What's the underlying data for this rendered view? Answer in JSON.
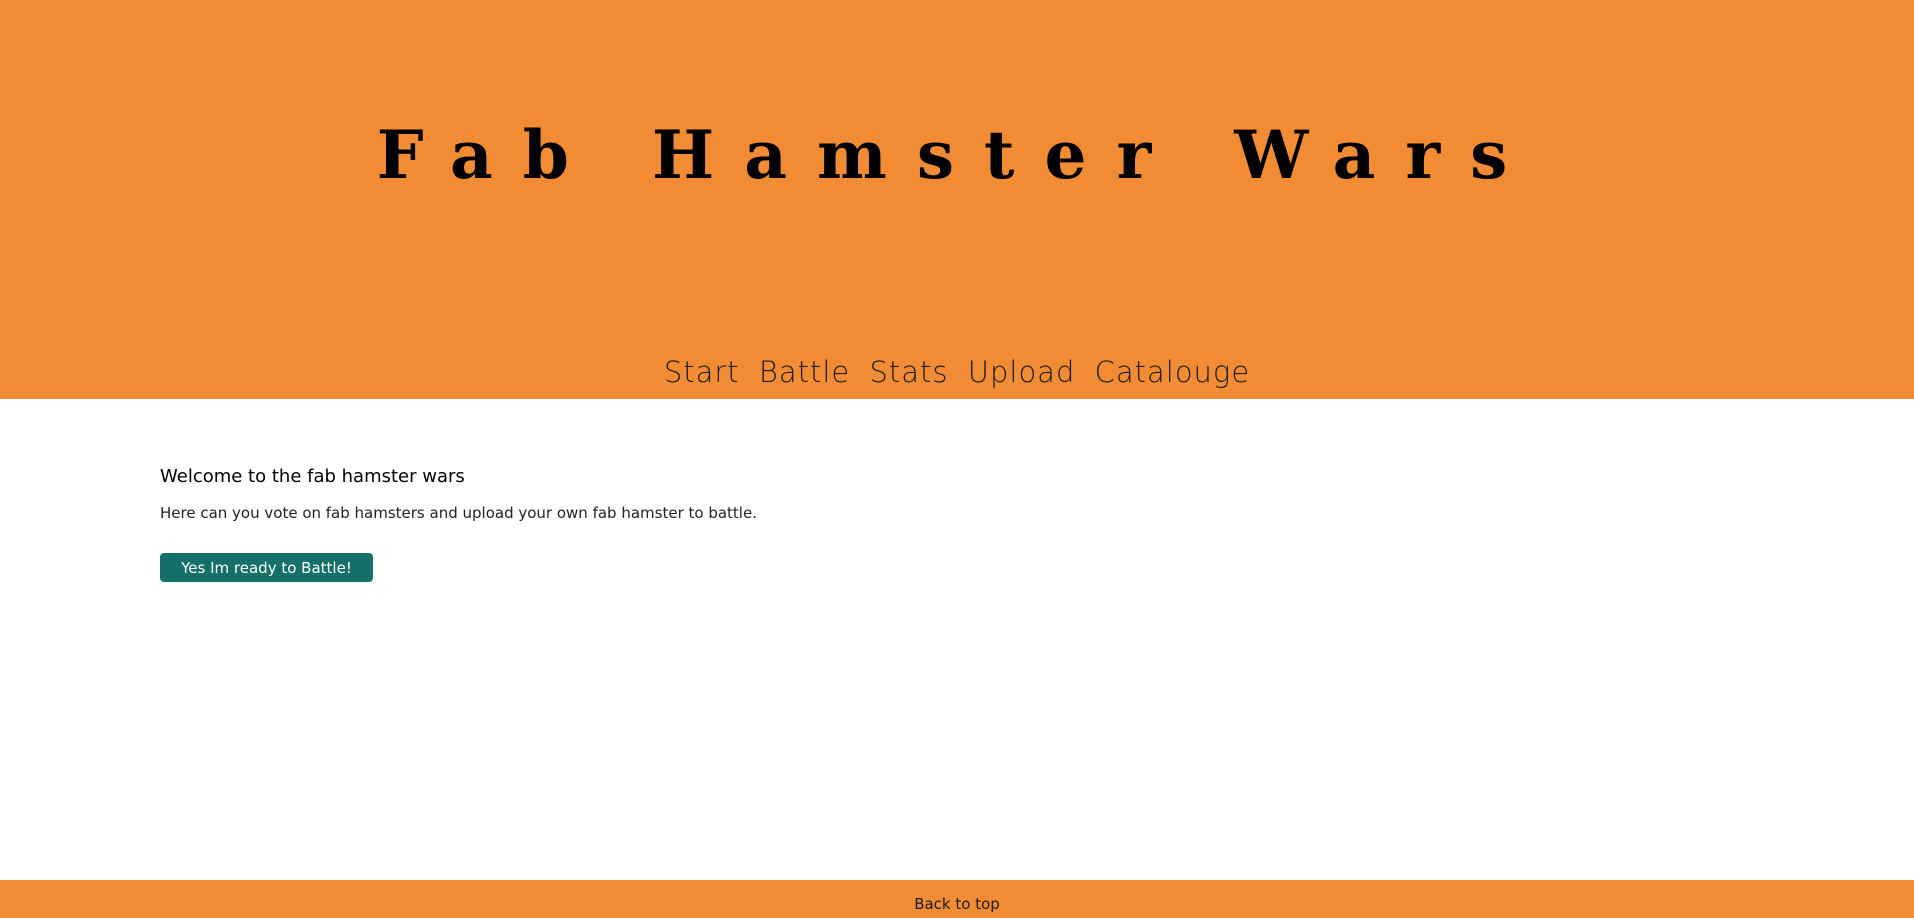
{
  "header": {
    "title": "Fab Hamster Wars",
    "background_color": "#f28c34",
    "nav": [
      {
        "label": "Start"
      },
      {
        "label": "Battle"
      },
      {
        "label": "Stats"
      },
      {
        "label": "Upload"
      },
      {
        "label": "Catalouge"
      }
    ]
  },
  "main": {
    "heading": "Welcome to the fab hamster wars",
    "description": "Here can you vote on fab hamsters and upload your own fab hamster to battle.",
    "cta_label": "Yes Im ready to Battle!",
    "cta_color": "#15706a"
  },
  "footer": {
    "back_to_top_label": "Back to top"
  }
}
